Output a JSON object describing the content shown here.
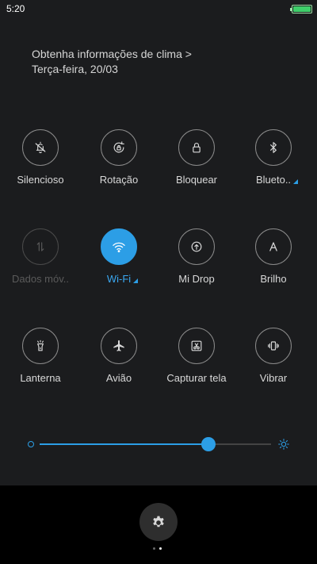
{
  "status_bar": {
    "time": "5:20",
    "battery_level": 1.0,
    "battery_color": "#3fcf6a"
  },
  "header": {
    "weather_text": "Obtenha informações de clima >",
    "date_text": "Terça-feira, 20/03"
  },
  "tiles": [
    {
      "label": "Silencioso",
      "icon": "bell-off-icon",
      "state": "off"
    },
    {
      "label": "Rotação",
      "icon": "rotation-lock-icon",
      "state": "off"
    },
    {
      "label": "Bloquear",
      "icon": "lock-icon",
      "state": "off"
    },
    {
      "label": "Blueto..",
      "icon": "bluetooth-icon",
      "state": "off",
      "has_more": true
    },
    {
      "label": "Dados móv..",
      "icon": "mobile-data-icon",
      "state": "disabled"
    },
    {
      "label": "Wi-Fi",
      "icon": "wifi-icon",
      "state": "on",
      "has_more": true
    },
    {
      "label": "Mi Drop",
      "icon": "mi-drop-icon",
      "state": "off"
    },
    {
      "label": "Brilho",
      "icon": "brightness-auto-icon",
      "state": "off"
    },
    {
      "label": "Lanterna",
      "icon": "flashlight-icon",
      "state": "off"
    },
    {
      "label": "Avião",
      "icon": "airplane-icon",
      "state": "off"
    },
    {
      "label": "Capturar tela",
      "icon": "screenshot-icon",
      "state": "off"
    },
    {
      "label": "Vibrar",
      "icon": "vibrate-icon",
      "state": "off"
    }
  ],
  "brightness": {
    "level": 0.73
  },
  "colors": {
    "accent": "#2c9ee6",
    "background": "#1b1c1e"
  },
  "pager": {
    "page_count": 2,
    "current_page": 2
  }
}
